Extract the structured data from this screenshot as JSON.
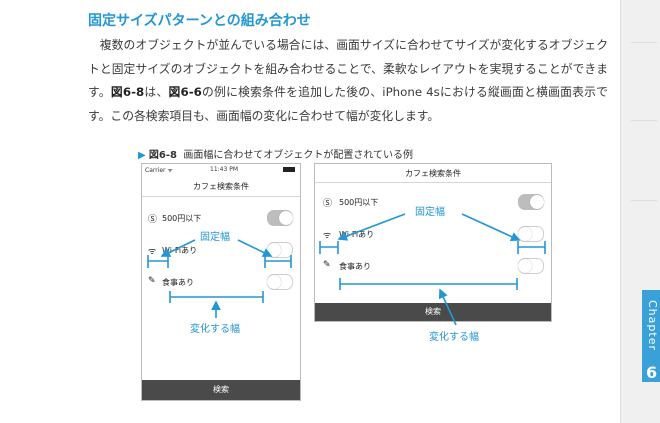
{
  "heading": "固定サイズパターンとの組み合わせ",
  "paragraph": {
    "p1": "複数のオブジェクトが並んでいる場合には、画面サイズに合わせてサイズが変化するオブジェクトと固定サイズのオブジェクトを組み合わせることで、柔軟なレイアウトを実現することができます。",
    "ref1": "図6-8",
    "p2": "は、",
    "ref2": "図6-6",
    "p3": "の例に検索条件を追加した後の、iPhone 4sにおける縦画面と横画面表示です。この各検索項目も、画面幅の変化に合わせて幅が変化します。"
  },
  "figure": {
    "number": "図6-8",
    "caption": "画面幅に合わせてオブジェクトが配置されている例"
  },
  "portrait": {
    "carrier": "Carrier ᯤ",
    "time": "11:43 PM",
    "nav_title": "カフェ検索条件",
    "rows": [
      {
        "icon": "yen-coin-icon",
        "glyph": "Ⓢ",
        "label": "500円以下",
        "toggle": "on"
      },
      {
        "icon": "wifi-icon",
        "glyph": "ᯤ",
        "label": "Wi-Fiあり",
        "toggle": "off"
      },
      {
        "icon": "bread-icon",
        "glyph": "✎",
        "label": "食事あり",
        "toggle": "off"
      }
    ],
    "search_label": "検索",
    "annot_fixed": "固定幅",
    "annot_variable": "変化する幅"
  },
  "landscape": {
    "nav_title": "カフェ検索条件",
    "rows": [
      {
        "icon": "yen-coin-icon",
        "glyph": "Ⓢ",
        "label": "500円以下",
        "toggle": "on"
      },
      {
        "icon": "wifi-icon",
        "glyph": "ᯤ",
        "label": "Wi-Fiあり",
        "toggle": "off"
      },
      {
        "icon": "bread-icon",
        "glyph": "✎",
        "label": "食事あり",
        "toggle": "off"
      }
    ],
    "search_label": "検索",
    "annot_fixed": "固定幅",
    "annot_variable": "変化する幅"
  },
  "sidebar": {
    "chapter_label": "Chapter",
    "chapter_number": "6"
  },
  "colors": {
    "accent": "#2396d4",
    "search_bar": "#4a4a4a"
  }
}
